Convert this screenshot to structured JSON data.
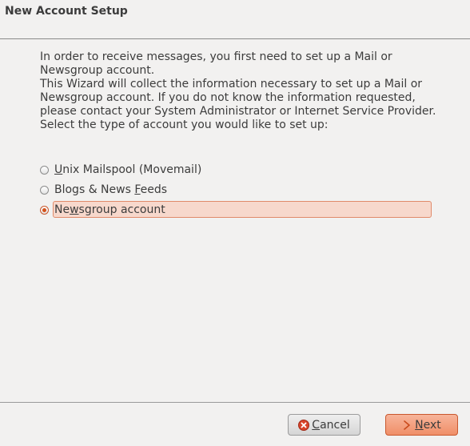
{
  "window": {
    "title": "New Account Setup"
  },
  "intro": {
    "line1": "In order to receive messages, you first need to set up a Mail or Newsgroup account.",
    "line2": "This Wizard will collect the information necessary to set up a Mail or Newsgroup account. If you do not know the information requested, please contact your System Administrator or Internet Service Provider.",
    "prompt": "Select the type of account you would like to set up:"
  },
  "options": [
    {
      "label_pre": "",
      "label_key": "U",
      "label_post": "nix Mailspool (Movemail)",
      "checked": false
    },
    {
      "label_pre": "Blogs & News ",
      "label_key": "F",
      "label_post": "eeds",
      "checked": false
    },
    {
      "label_pre": "Ne",
      "label_key": "w",
      "label_post": "sgroup account",
      "checked": true
    }
  ],
  "buttons": {
    "cancel_label": "Cancel",
    "cancel_key": "C",
    "cancel_rest": "ancel",
    "next_key": "N",
    "next_rest": "ext"
  },
  "colors": {
    "accent": "#f08f68",
    "radio_checked": "#d4531c"
  },
  "icons": {
    "cancel": "cancel-x-icon",
    "next": "chevron-right-icon"
  }
}
